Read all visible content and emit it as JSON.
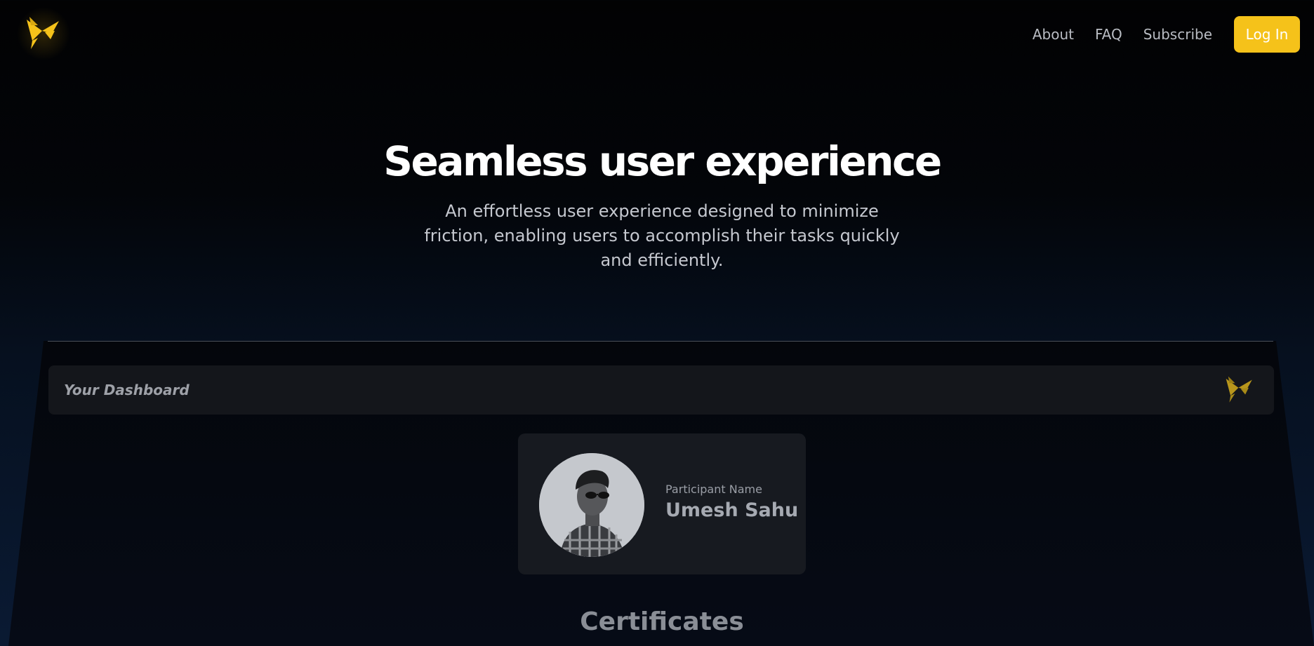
{
  "nav": {
    "links": [
      "About",
      "FAQ",
      "Subscribe"
    ],
    "login_label": "Log In",
    "logo_icon": "origami-bird-logo-icon"
  },
  "hero": {
    "title": "Seamless user experience",
    "subtitle": "An effortless user experience designed to minimize friction, enabling users to accomplish their tasks quickly and efficiently."
  },
  "dashboard": {
    "title": "Your Dashboard",
    "participant_label": "Participant Name",
    "participant_name": "Umesh Sahu",
    "section_heading": "Certificates"
  },
  "colors": {
    "accent": "#f5c21a",
    "background": "#020203",
    "card": "#171a20"
  }
}
